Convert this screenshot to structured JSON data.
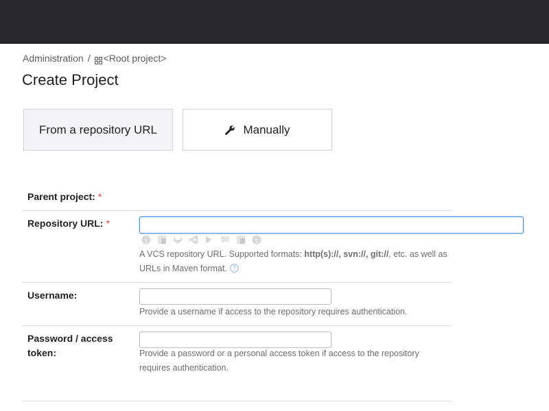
{
  "breadcrumb": {
    "root": "Administration",
    "separator": "/",
    "current": "<Root project>",
    "current_icon": "project-icon"
  },
  "page": {
    "title": "Create Project"
  },
  "tabs": [
    {
      "label": "From a repository URL",
      "selected": true
    },
    {
      "label": "Manually",
      "icon": "wrench-icon",
      "selected": false
    }
  ],
  "form": {
    "parent_project": {
      "label": "Parent project:",
      "required_mark": "*"
    },
    "repository_url": {
      "label": "Repository URL:",
      "required_mark": "*",
      "value": "",
      "vcs_icons": [
        "github-icon",
        "bitbucket-icon",
        "gitlab-icon",
        "visual-studio-icon",
        "azure-devops-icon",
        "space-icon",
        "bitbucket-server-icon",
        "github-enterprise-icon"
      ],
      "hint_prefix": "A VCS repository URL. Supported formats: ",
      "hint_formats": "http(s)://, svn://, git://",
      "hint_suffix": ", etc. as well as URLs in Maven format."
    },
    "username": {
      "label": "Username:",
      "value": "",
      "hint": "Provide a username if access to the repository requires authentication."
    },
    "password": {
      "label": "Password / access token:",
      "value": "",
      "hint": "Provide a password or a personal access token if access to the repository requires authentication."
    }
  },
  "colors": {
    "topbar": "#27282c",
    "required": "#e0453e",
    "focus_border": "#4a8ee6",
    "selected_tab_bg": "#f2f4f8"
  }
}
